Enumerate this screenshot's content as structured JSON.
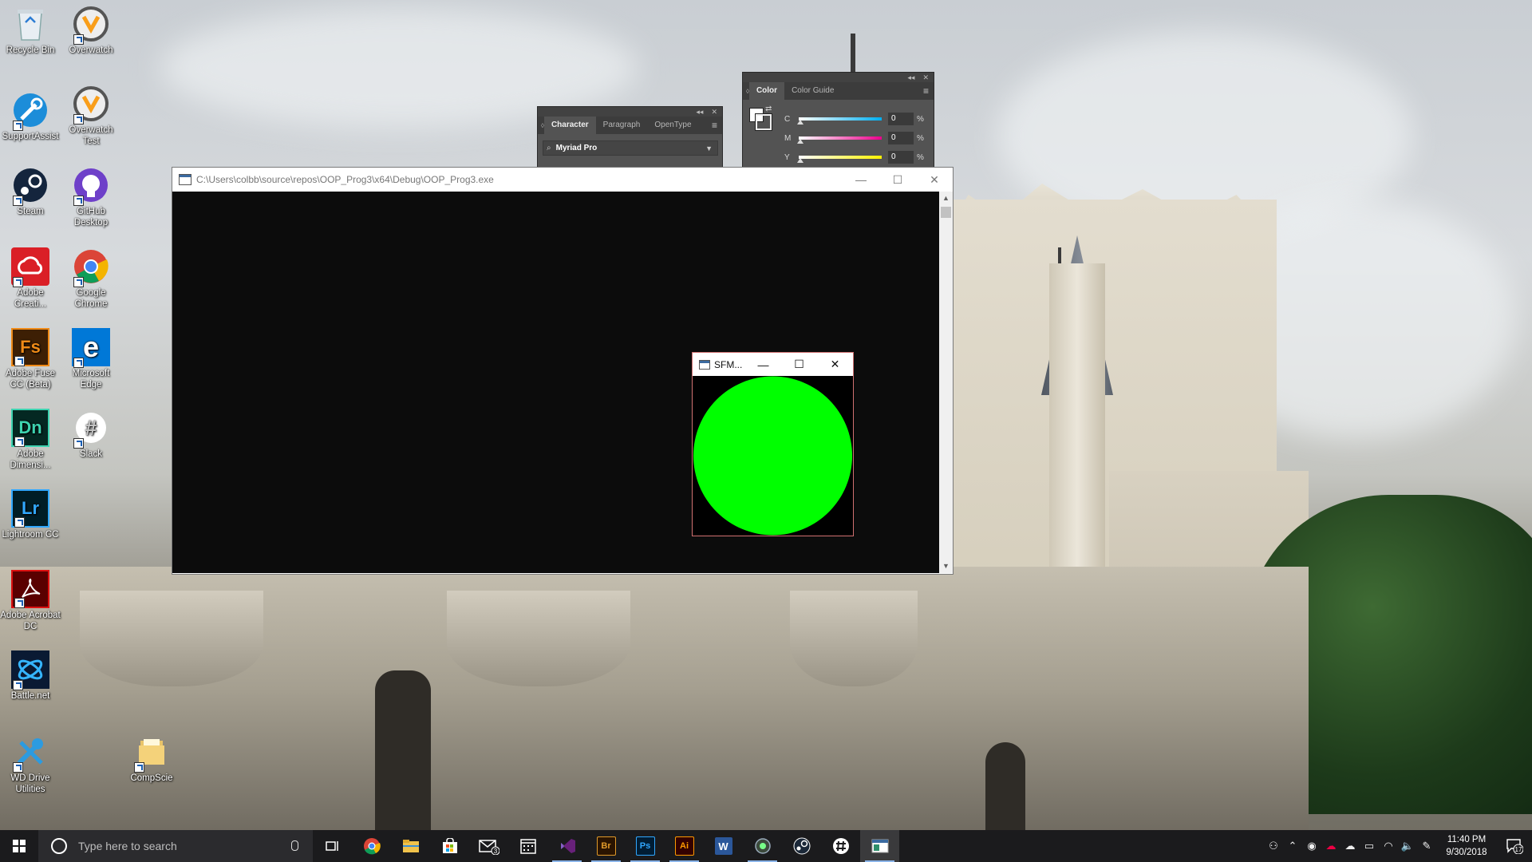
{
  "desktop": {
    "icons": [
      {
        "label": "Recycle Bin",
        "icon": "recycle-bin-icon"
      },
      {
        "label": "Overwatch",
        "icon": "overwatch-icon"
      },
      {
        "label": "SupportAssist",
        "icon": "supportassist-icon"
      },
      {
        "label": "Overwatch Test",
        "icon": "overwatch-icon"
      },
      {
        "label": "Steam",
        "icon": "steam-icon"
      },
      {
        "label": "GitHub Desktop",
        "icon": "github-icon"
      },
      {
        "label": "Adobe Creati...",
        "icon": "creative-cloud-icon"
      },
      {
        "label": "Google Chrome",
        "icon": "chrome-icon"
      },
      {
        "label": "Adobe Fuse CC (Beta)",
        "icon": "fuse-icon",
        "glyph": "Fs"
      },
      {
        "label": "Microsoft Edge",
        "icon": "edge-icon",
        "glyph": "e"
      },
      {
        "label": "Adobe Dimensi...",
        "icon": "dimension-icon",
        "glyph": "Dn"
      },
      {
        "label": "Slack",
        "icon": "slack-icon",
        "glyph": "#"
      },
      {
        "label": "Lightroom CC",
        "icon": "lightroom-icon",
        "glyph": "Lr"
      },
      {
        "label": "Adobe Acrobat DC",
        "icon": "acrobat-icon"
      },
      {
        "label": "Battle.net",
        "icon": "battlenet-icon"
      },
      {
        "label": "WD Drive Utilities",
        "icon": "wd-tools-icon"
      },
      {
        "label": "CompScie",
        "icon": "folder-icon"
      }
    ]
  },
  "character_panel": {
    "tabs": [
      "Character",
      "Paragraph",
      "OpenType"
    ],
    "font_value": "Myriad Pro"
  },
  "color_panel": {
    "tabs": [
      "Color",
      "Color Guide"
    ],
    "channels": [
      {
        "label": "C",
        "value": "0",
        "unit": "%"
      },
      {
        "label": "M",
        "value": "0",
        "unit": "%"
      },
      {
        "label": "Y",
        "value": "0",
        "unit": "%"
      }
    ]
  },
  "console_window": {
    "title": "C:\\Users\\colbb\\source\\repos\\OOP_Prog3\\x64\\Debug\\OOP_Prog3.exe",
    "minimize": "—",
    "maximize": "☐",
    "close": "✕"
  },
  "sfml_window": {
    "title": "SFM...",
    "minimize": "—",
    "maximize": "☐",
    "close": "✕",
    "shape": "circle",
    "fill": "#00ff00"
  },
  "taskbar": {
    "search_placeholder": "Type here to search",
    "apps": [
      {
        "name": "chrome",
        "icon": "chrome-icon"
      },
      {
        "name": "file-explorer",
        "icon": "folder-icon"
      },
      {
        "name": "store",
        "icon": "store-icon"
      },
      {
        "name": "mail",
        "icon": "mail-icon",
        "badge": "3"
      },
      {
        "name": "calendar",
        "icon": "calendar-icon"
      },
      {
        "name": "visual-studio",
        "icon": "visual-studio-icon"
      },
      {
        "name": "bridge",
        "icon": "bridge-icon",
        "glyph": "Br"
      },
      {
        "name": "photoshop",
        "icon": "photoshop-icon",
        "glyph": "Ps"
      },
      {
        "name": "illustrator",
        "icon": "illustrator-icon",
        "glyph": "Ai"
      },
      {
        "name": "word",
        "icon": "word-icon",
        "glyph": "W"
      },
      {
        "name": "app",
        "icon": "app-icon"
      },
      {
        "name": "steam",
        "icon": "steam-icon"
      },
      {
        "name": "slack",
        "icon": "slack-icon"
      },
      {
        "name": "console",
        "icon": "console-icon"
      }
    ],
    "time": "11:40 PM",
    "date": "9/30/2018",
    "notification_count": "17"
  }
}
